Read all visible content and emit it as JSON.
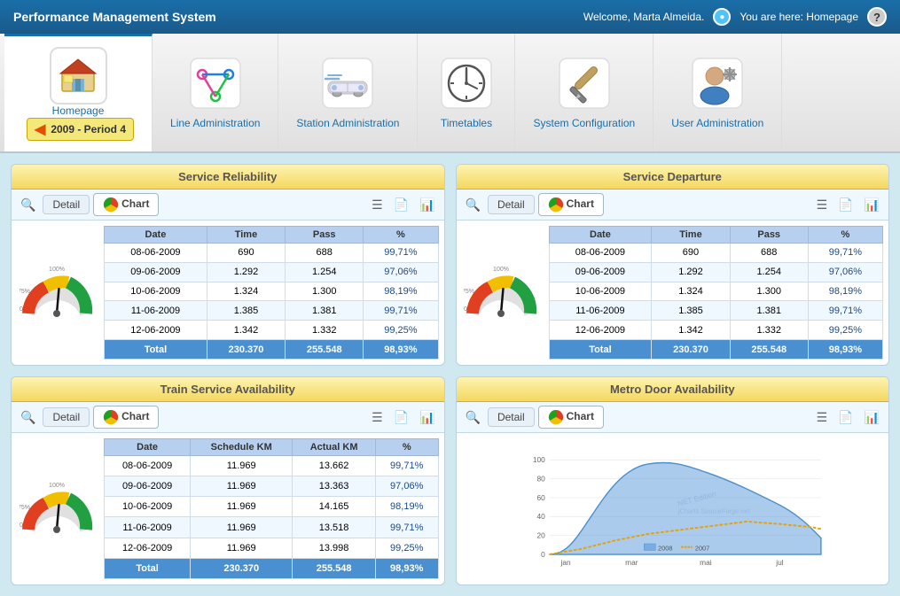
{
  "header": {
    "title": "Performance Management System",
    "welcome": "Welcome, Marta Almeida.",
    "location": "You are here: Homepage"
  },
  "nav": {
    "items": [
      {
        "label": "Homepage",
        "active": true
      },
      {
        "label": "Line Administration",
        "active": false
      },
      {
        "label": "Station Administration",
        "active": false
      },
      {
        "label": "Timetables",
        "active": false
      },
      {
        "label": "System Configuration",
        "active": false
      },
      {
        "label": "User Administration",
        "active": false
      }
    ],
    "period": "2009 - Period 4"
  },
  "panels": [
    {
      "id": "service-reliability",
      "title": "Service Reliability",
      "tabs": [
        "Detail",
        "Chart"
      ],
      "activeTab": "Chart",
      "columns": [
        "Date",
        "Time",
        "Pass",
        "%"
      ],
      "rows": [
        [
          "08-06-2009",
          "690",
          "688",
          "99,71%"
        ],
        [
          "09-06-2009",
          "1.292",
          "1.254",
          "97,06%"
        ],
        [
          "10-06-2009",
          "1.324",
          "1.300",
          "98,19%"
        ],
        [
          "11-06-2009",
          "1.385",
          "1.381",
          "99,71%"
        ],
        [
          "12-06-2009",
          "1.342",
          "1.332",
          "99,25%"
        ]
      ],
      "total": [
        "Total",
        "230.370",
        "255.548",
        "98,93%"
      ]
    },
    {
      "id": "service-departure",
      "title": "Service Departure",
      "tabs": [
        "Detail",
        "Chart"
      ],
      "activeTab": "Chart",
      "columns": [
        "Date",
        "Time",
        "Pass",
        "%"
      ],
      "rows": [
        [
          "08-06-2009",
          "690",
          "688",
          "99,71%"
        ],
        [
          "09-06-2009",
          "1.292",
          "1.254",
          "97,06%"
        ],
        [
          "10-06-2009",
          "1.324",
          "1.300",
          "98,19%"
        ],
        [
          "11-06-2009",
          "1.385",
          "1.381",
          "99,71%"
        ],
        [
          "12-06-2009",
          "1.342",
          "1.332",
          "99,25%"
        ]
      ],
      "total": [
        "Total",
        "230.370",
        "255.548",
        "98,93%"
      ]
    },
    {
      "id": "train-service-availability",
      "title": "Train Service Availability",
      "tabs": [
        "Detail",
        "Chart"
      ],
      "activeTab": "Chart",
      "columns": [
        "Date",
        "Schedule KM",
        "Actual KM",
        "%"
      ],
      "rows": [
        [
          "08-06-2009",
          "11.969",
          "13.662",
          "99,71%"
        ],
        [
          "09-06-2009",
          "11.969",
          "13.363",
          "97,06%"
        ],
        [
          "10-06-2009",
          "11.969",
          "14.165",
          "98,19%"
        ],
        [
          "11-06-2009",
          "11.969",
          "13.518",
          "99,71%"
        ],
        [
          "12-06-2009",
          "11.969",
          "13.998",
          "99,25%"
        ]
      ],
      "total": [
        "Total",
        "230.370",
        "255.548",
        "98,93%"
      ]
    },
    {
      "id": "metro-door-availability",
      "title": "Metro Door Availability",
      "tabs": [
        "Detail",
        "Chart"
      ],
      "activeTab": "Chart",
      "chartYLabels": [
        "0",
        "20",
        "40",
        "60",
        "80",
        "100"
      ],
      "chartXLabels": [
        "jan",
        "mar",
        "mai",
        "jul"
      ],
      "chartLegend": [
        "2008",
        "2007"
      ]
    }
  ]
}
